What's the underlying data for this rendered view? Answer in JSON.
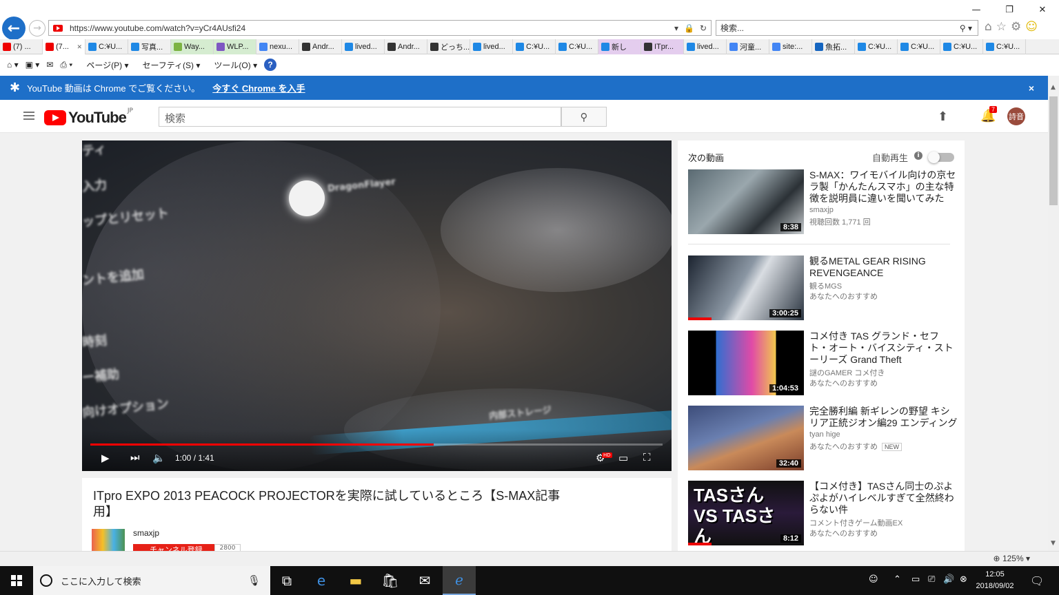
{
  "browser": {
    "url": "https://www.youtube.com/watch?v=yCr4AUsfi24",
    "search_placeholder": "検索...",
    "tabs": [
      {
        "label": "(7) ...",
        "color": "#e00"
      },
      {
        "label": "(7...",
        "color": "#e00",
        "active": true
      },
      {
        "label": "C:¥U...",
        "color": "#1e88e5"
      },
      {
        "label": "写真...",
        "color": "#1e88e5"
      },
      {
        "label": "Way...",
        "color": "#7cb342",
        "tint": "green"
      },
      {
        "label": "WLP...",
        "color": "#7e57c2",
        "tint": "green"
      },
      {
        "label": "nexu...",
        "color": "#4285f4"
      },
      {
        "label": "Andr...",
        "color": "#333"
      },
      {
        "label": "lived...",
        "color": "#1e88e5"
      },
      {
        "label": "Andr...",
        "color": "#333"
      },
      {
        "label": "どっち...",
        "color": "#333"
      },
      {
        "label": "lived...",
        "color": "#1e88e5"
      },
      {
        "label": "C:¥U...",
        "color": "#1e88e5"
      },
      {
        "label": "C:¥U...",
        "color": "#1e88e5"
      },
      {
        "label": "新し",
        "color": "#1e88e5",
        "tint": "purple"
      },
      {
        "label": "ITpr...",
        "color": "#333",
        "tint": "purple"
      },
      {
        "label": "lived...",
        "color": "#1e88e5"
      },
      {
        "label": "河童...",
        "color": "#4285f4"
      },
      {
        "label": "site:...",
        "color": "#4285f4"
      },
      {
        "label": "魚拓...",
        "color": "#1565c0"
      },
      {
        "label": "C:¥U...",
        "color": "#1e88e5"
      },
      {
        "label": "C:¥U...",
        "color": "#1e88e5"
      },
      {
        "label": "C:¥U...",
        "color": "#1e88e5"
      },
      {
        "label": "C:¥U...",
        "color": "#1e88e5"
      }
    ],
    "cmd": {
      "page": "ページ(P)",
      "safety": "セーフティ(S)",
      "tools": "ツール(O)"
    }
  },
  "banner": {
    "text": "YouTube 動画は Chrome でご覧ください。",
    "link": "今すぐ Chrome を入手",
    "close": "×"
  },
  "yt": {
    "logo_text": "YouTube",
    "logo_region": "JP",
    "search_placeholder": "検索",
    "notification_count": "7",
    "avatar_text": "詩音"
  },
  "video": {
    "time": "1:00 / 1:41",
    "progress": 0.6,
    "hd_badge": "HD",
    "overlay_text": [
      "ティ",
      "入力",
      "ップとリセット",
      "ントを追加",
      "時刻",
      "ー補助",
      "向けオプション",
      "内部ストレージ",
      "DragonFlayer"
    ],
    "title": "ITpro EXPO 2013 PEACOCK PROJECTORを実際に試しているところ【S-MAX記事用】",
    "channel": "smaxjp",
    "subscribe_label": "チャンネル登録",
    "subscriber_count": "2800"
  },
  "sidebar": {
    "up_next": "次の動画",
    "autoplay": "自動再生",
    "items": [
      {
        "title": "S-MAX：ワイモバイル向けの京セラ製「かんたんスマホ」の主な特徴を説明員に違いを聞いてみた",
        "channel": "smaxjp",
        "meta": "視聴回数 1,771 回",
        "duration": "8:38",
        "thumb": "linear-gradient(135deg,#5a6a72,#9aa7ad 40%,#2b3136 70%,#c9ced1)"
      },
      {
        "title": "観るMETAL GEAR RISING REVENGEANCE",
        "channel": "観るMGS",
        "meta": "あなたへのおすすめ",
        "duration": "3:00:25",
        "thumb": "linear-gradient(120deg,#1c2430,#8a96a3 45%,#d9dde2 55%,#2a3440)",
        "watched": true
      },
      {
        "title": "コメ付き TAS グランド・セフト・オート・バイスシティ・ストーリーズ Grand Theft",
        "channel": "謎のGAMER コメ付き",
        "meta": "あなたへのおすすめ",
        "duration": "1:04:53",
        "thumb": "linear-gradient(90deg,#000 0%,#000 24%,#2f6fd1 24%,#e04aa7 55%,#f2c94c 76%,#000 76%)"
      },
      {
        "title": "完全勝利編 新ギレンの野望 キシリア正統ジオン編29 エンディング",
        "channel": "tyan hige",
        "meta": "あなたへのおすすめ",
        "duration": "32:40",
        "thumb": "linear-gradient(160deg,#3d4d7a,#6a7fb0 40%,#c98a5a 60%,#7a3d2a)",
        "new": "NEW"
      },
      {
        "title": "【コメ付き】TASさん同士のぷよぷよがハイレベルすぎて全然終わらない件",
        "channel": "コメント付きゲーム動画EX",
        "meta": "あなたへのおすすめ",
        "duration": "8:12",
        "thumb": "linear-gradient(180deg,#111 0%,#2a1a3a 50%,#111 100%)",
        "watched": true,
        "overlay": "TASさん VS TASさん"
      }
    ]
  },
  "status": {
    "zoom": "125%"
  },
  "taskbar": {
    "search_placeholder": "ここに入力して検索",
    "time": "12:05",
    "date": "2018/09/02"
  }
}
